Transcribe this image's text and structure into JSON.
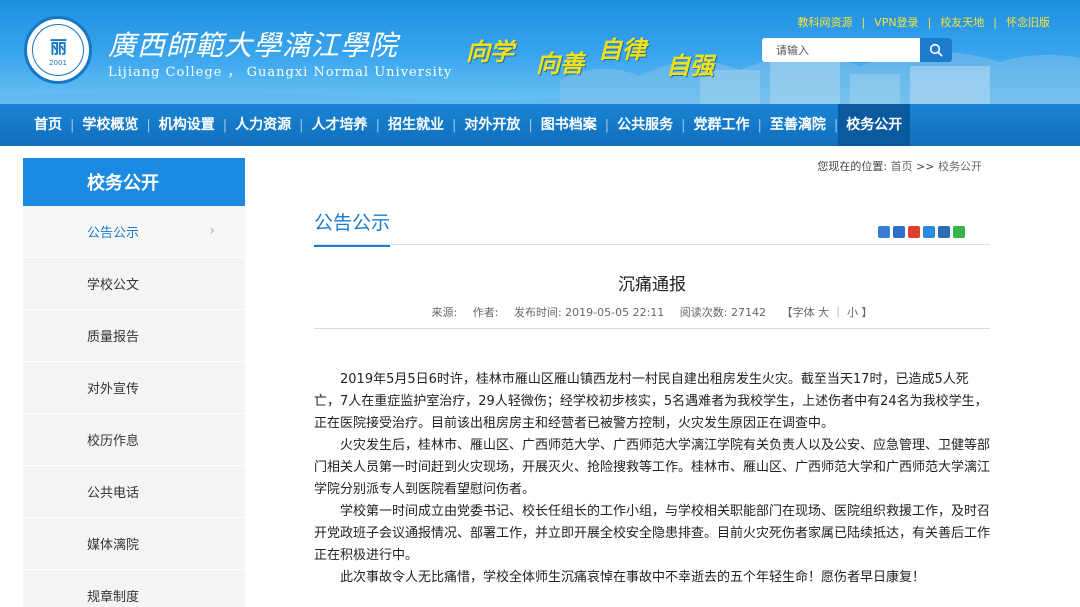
{
  "header": {
    "school_name_cn": "廣西師範大學漓江學院",
    "school_name_en": "Lijiang College ， Guangxi Normal University",
    "logo_year": "2001",
    "motto": [
      "向学",
      "向善",
      "自律",
      "自强"
    ],
    "top_links": [
      "教科网资源",
      "VPN登录",
      "校友天地",
      "怀念旧版"
    ],
    "search_placeholder": "请输入"
  },
  "nav": {
    "items": [
      "首页",
      "学校概览",
      "机构设置",
      "人力资源",
      "人才培养",
      "招生就业",
      "对外开放",
      "图书档案",
      "公共服务",
      "党群工作",
      "至善漓院",
      "校务公开"
    ],
    "active_index": 11
  },
  "sidebar": {
    "title": "校务公开",
    "items": [
      "公告公示",
      "学校公文",
      "质量报告",
      "对外宣传",
      "校历作息",
      "公共电话",
      "媒体漓院",
      "规章制度"
    ],
    "active_index": 0
  },
  "breadcrumb": {
    "prefix": "您现在的位置:",
    "home": "首页",
    "sep": ">>",
    "current": "校务公开"
  },
  "section_title": "公告公示",
  "article": {
    "title": "沉痛通报",
    "meta": {
      "source": "来源:",
      "author": "作者:",
      "published": "发布时间: 2019-05-05 22:11",
      "views": "阅读次数: 27142",
      "font_size": "【字体 大 ｜ 小 】"
    },
    "paragraphs": [
      "2019年5月5日6时许，桂林市雁山区雁山镇西龙村一村民自建出租房发生火灾。截至当天17时，已造成5人死亡，7人在重症监护室治疗，29人轻微伤；经学校初步核实，5名遇难者为我校学生，上述伤者中有24名为我校学生，正在医院接受治疗。目前该出租房房主和经营者已被警方控制，火灾发生原因正在调查中。",
      "火灾发生后，桂林市、雁山区、广西师范大学、广西师范大学漓江学院有关负责人以及公安、应急管理、卫健等部门相关人员第一时间赶到火灾现场，开展灭火、抢险搜救等工作。桂林市、雁山区、广西师范大学和广西师范大学漓江学院分别派专人到医院看望慰问伤者。",
      "学校第一时间成立由党委书记、校长任组长的工作小组，与学校相关职能部门在现场、医院组织救援工作，及时召开党政班子会议通报情况、部署工作，并立即开展全校安全隐患排查。目前火灾死伤者家属已陆续抵达，有关善后工作正在积极进行中。",
      "此次事故令人无比痛惜，学校全体师生沉痛哀悼在事故中不幸逝去的五个年轻生命！愿伤者早日康复！"
    ]
  },
  "colors": {
    "header_blue": "#1e8fe0",
    "nav_blue": "#0f6fbd",
    "accent": "#1b7ccc",
    "motto_yellow": "#f2e01a"
  },
  "icons": [
    "search-icon",
    "chevron-right-icon",
    "share-icons"
  ]
}
